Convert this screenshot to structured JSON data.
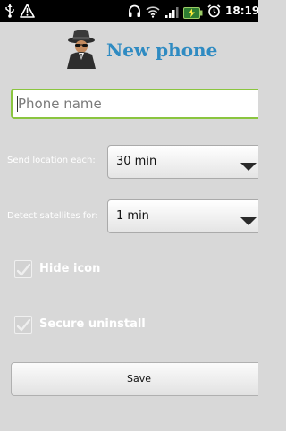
{
  "status_bar": {
    "time": "18:19",
    "icons": [
      "usb-icon",
      "warning-icon",
      "headphones-icon",
      "wifi-icon",
      "signal-icon",
      "battery-icon",
      "alarm-icon"
    ]
  },
  "header": {
    "title": "New phone",
    "icon": "spy-icon"
  },
  "phone_name": {
    "placeholder": "Phone name",
    "value": ""
  },
  "send_location": {
    "label": "Send location each:",
    "value": "30 min"
  },
  "detect_satellites": {
    "label": "Detect satellites for:",
    "value": "1 min"
  },
  "hide_icon": {
    "label": "Hide icon",
    "checked": true
  },
  "secure_uninstall": {
    "label": "Secure uninstall",
    "checked": true
  },
  "save_button": {
    "label": "Save"
  },
  "colors": {
    "background": "#d8d8d8",
    "title": "#2f8bc2",
    "input_focus_border": "#8ac53f",
    "status_bar": "#000000",
    "status_accent": "#4caf50"
  }
}
